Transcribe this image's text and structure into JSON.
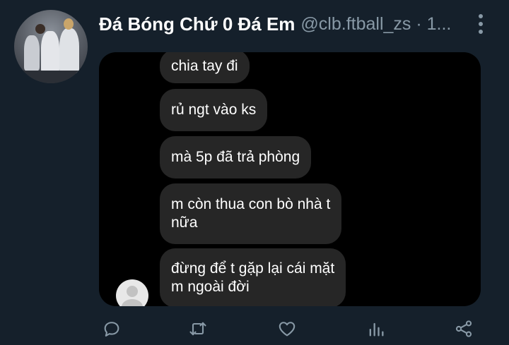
{
  "tweet": {
    "display_name": "Đá Bóng Chứ 0 Đá Em",
    "handle": "@clb.ftball_zs · 1...",
    "more_icon": "more-vertical-icon"
  },
  "image": {
    "messages": [
      {
        "text": "chia tay đi"
      },
      {
        "text": "rủ ngt vào ks"
      },
      {
        "text": "mà 5p đã trả phòng"
      },
      {
        "line1": "m còn thua con bò nhà t",
        "line2": "nữa"
      },
      {
        "line1": "đừng để t gặp lại cái mặt",
        "line2": "m ngoài đời"
      }
    ]
  },
  "actions": {
    "reply_icon": "reply-icon",
    "retweet_icon": "retweet-icon",
    "like_icon": "heart-icon",
    "analytics_icon": "analytics-icon",
    "share_icon": "share-icon",
    "icon_color": "#8899a6"
  }
}
